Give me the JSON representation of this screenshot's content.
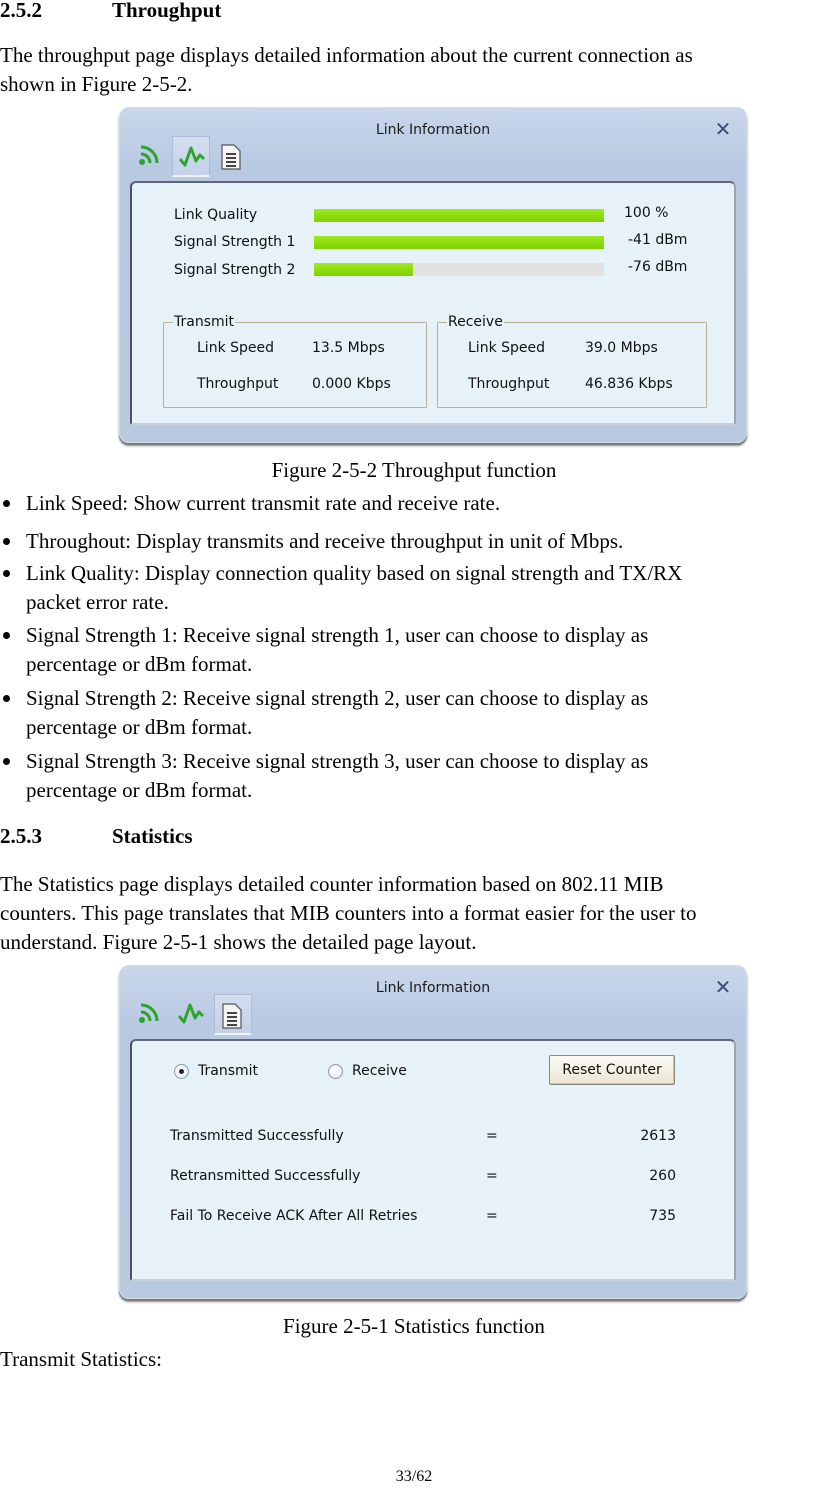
{
  "section_252": {
    "number": "2.5.2",
    "title": "Throughput",
    "intro_line1": "The throughput page displays detailed information about the current connection as",
    "intro_line2": "shown in Figure 2-5-2."
  },
  "figure_throughput": {
    "window_title": "Link Information",
    "close_label": "✕",
    "tabs": [
      {
        "icon": "wireless-signal-icon",
        "active": false
      },
      {
        "icon": "throughput-graph-icon",
        "active": true
      },
      {
        "icon": "statistics-document-icon",
        "active": false
      }
    ],
    "meters": [
      {
        "label": "Link Quality",
        "value_text": "100 %",
        "fill_percent": 100
      },
      {
        "label": "Signal Strength 1",
        "value_text": "-41 dBm",
        "fill_percent": 100
      },
      {
        "label": "Signal Strength 2",
        "value_text": "-76 dBm",
        "fill_percent": 34
      }
    ],
    "transmit": {
      "legend": "Transmit",
      "link_speed_label": "Link Speed",
      "link_speed_value": "13.5 Mbps",
      "throughput_label": "Throughput",
      "throughput_value": "0.000 Kbps"
    },
    "receive": {
      "legend": "Receive",
      "link_speed_label": "Link Speed",
      "link_speed_value": "39.0 Mbps",
      "throughput_label": "Throughput",
      "throughput_value": "46.836 Kbps"
    },
    "caption": "Figure 2-5-2 Throughput function"
  },
  "bullets": [
    {
      "line1": "Link Speed: Show current transmit rate and receive rate.",
      "line2": ""
    },
    {
      "line1": "Throughout: Display transmits and receive throughput in unit of Mbps.",
      "line2": ""
    },
    {
      "line1": "Link Quality: Display connection quality based on signal strength and TX/RX",
      "line2": "packet error rate."
    },
    {
      "line1": "Signal Strength 1: Receive signal strength 1, user can choose to display as",
      "line2": "percentage or dBm format."
    },
    {
      "line1": "Signal Strength 2: Receive signal strength 2, user can choose to display as",
      "line2": "percentage or dBm format."
    },
    {
      "line1": "Signal Strength 3: Receive signal strength 3, user can choose to display as",
      "line2": "percentage or dBm format."
    }
  ],
  "section_253": {
    "number": "2.5.3",
    "title": "Statistics",
    "intro_line1": "The Statistics page displays detailed counter information based on 802.11 MIB",
    "intro_line2": "counters. This page translates that MIB counters into a format easier for the user to",
    "intro_line3": "understand. Figure 2-5-1 shows the detailed page layout."
  },
  "figure_statistics": {
    "window_title": "Link Information",
    "close_label": "✕",
    "tabs": [
      {
        "icon": "wireless-signal-icon",
        "active": false
      },
      {
        "icon": "throughput-graph-icon",
        "active": false
      },
      {
        "icon": "statistics-document-icon",
        "active": true
      }
    ],
    "radio_transmit": "Transmit",
    "radio_receive": "Receive",
    "selected": "Transmit",
    "reset_button": "Reset Counter",
    "counters": [
      {
        "label": "Transmitted Successfully",
        "eq": "=",
        "value": "2613"
      },
      {
        "label": "Retransmitted Successfully",
        "eq": "=",
        "value": "260"
      },
      {
        "label": "Fail To Receive ACK After All Retries",
        "eq": "=",
        "value": "735"
      }
    ],
    "caption": "Figure 2-5-1 Statistics function"
  },
  "trailing_text": "Transmit Statistics:",
  "page_number": "33/62"
}
